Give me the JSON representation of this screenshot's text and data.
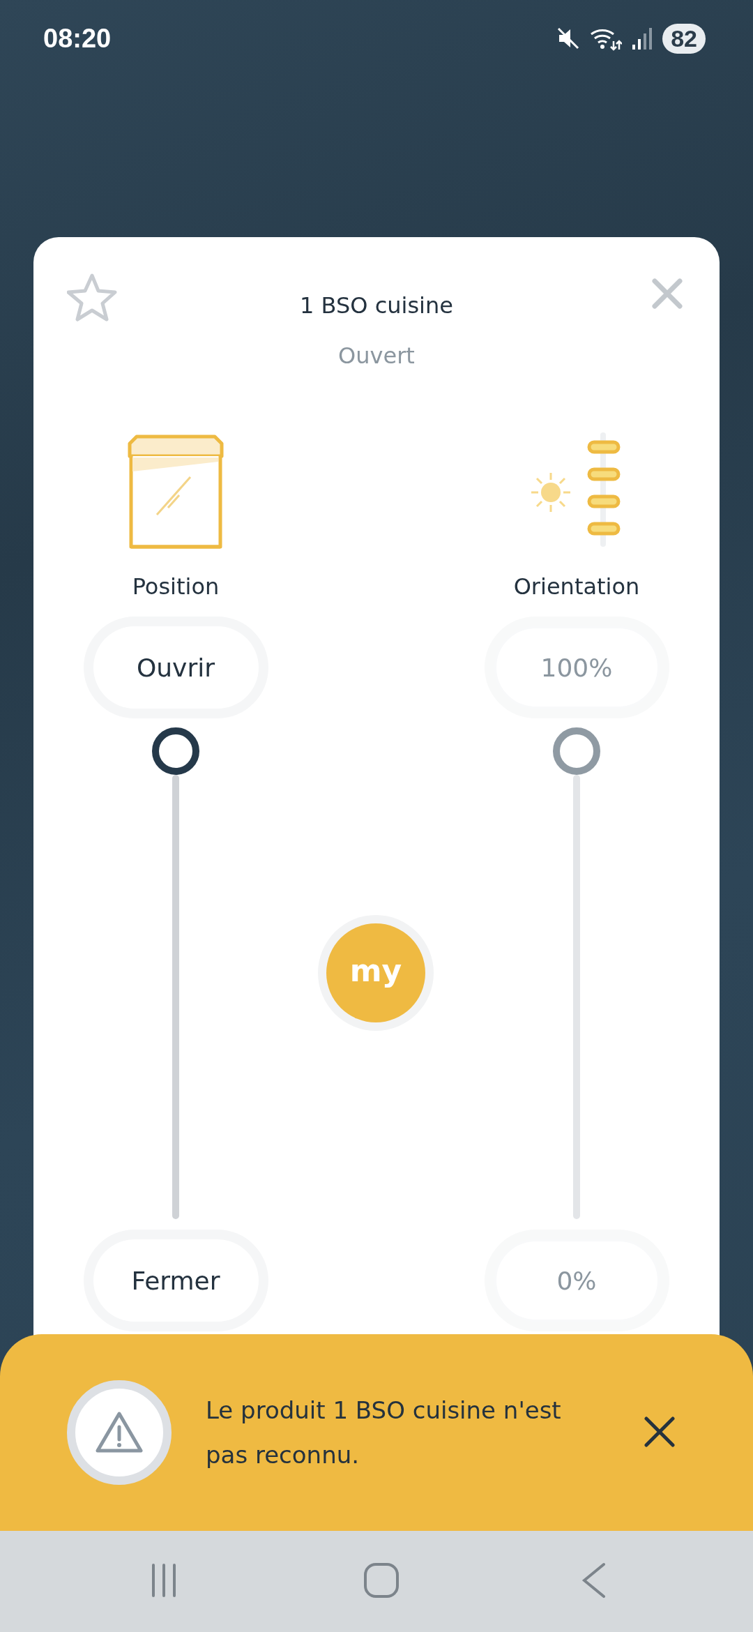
{
  "status_bar": {
    "time": "08:20",
    "battery": "82"
  },
  "header": {
    "favorite": false,
    "title": "1 BSO cuisine",
    "status": "Ouvert"
  },
  "controls": [
    {
      "kind": "position",
      "label": "Position",
      "top_button": "Ouvrir",
      "bottom_button": "Fermer",
      "level": 1,
      "disabled": false
    },
    {
      "kind": "orientation",
      "label": "Orientation",
      "top_button": "100%",
      "bottom_button": "0%",
      "level": 1,
      "disabled": true
    }
  ],
  "my_button": {
    "label": "my"
  },
  "alert": {
    "message": "Le produit 1 BSO cuisine n'est pas reconnu."
  }
}
